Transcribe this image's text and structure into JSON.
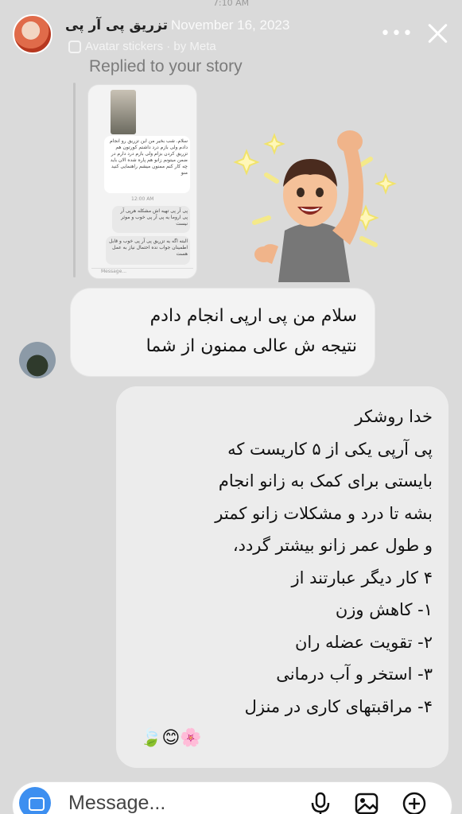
{
  "statusbar": {
    "time": "7:10 AM"
  },
  "header": {
    "username": "تزریق پی آر پی",
    "date": "November 16, 2023",
    "sticker_label": "Avatar stickers · by Meta"
  },
  "reply": {
    "label": "Replied to your story",
    "thumbnail": {
      "bubble_1": "سلام. شب بخیر من این تزریق رو انجام دادم ولی بازم درد داشتم کورتون هم تزریق کردن بزام ولی بازم درد دارم در ضمن میتونم زانو هم پاره شده الان باید چه کار کنم ممنون میشم راهنمایی کنید منو",
      "time": "12:00 AM",
      "bubble_2": "پی آر پی تهیه اش مشکله هرپی آر پی اروما یه پی آر پی خوب و موثر نیست",
      "bubble_3": "البته اگه یه تزریق پی آر پی خوب و قابل اطمینان جواب نده احتمال نیاز به عمل هست",
      "input": "Message..."
    }
  },
  "messages": {
    "incoming": {
      "lines": [
        "سلام من پی ارپی انجام دادم",
        "نتیجه ش عالی ممنون از شما"
      ]
    },
    "outgoing": {
      "lines": [
        "خدا روشکر",
        "پی آرپی یکی از ۵ کاریست که",
        "بایستی برای کمک به زانو انجام",
        "بشه تا درد و مشکلات زانو کمتر",
        "و طول عمر زانو بیشتر گردد،",
        "۴ کار دیگر عبارتند از",
        "۱- کاهش وزن",
        "۲- تقویت عضله ران",
        "۳- استخر و آب درمانی",
        "۴- مراقبتهای کاری در منزل"
      ],
      "emojis": "🍃😊🌸"
    }
  },
  "composer": {
    "placeholder": "Message...",
    "accent_color": "#3d8ff0"
  }
}
